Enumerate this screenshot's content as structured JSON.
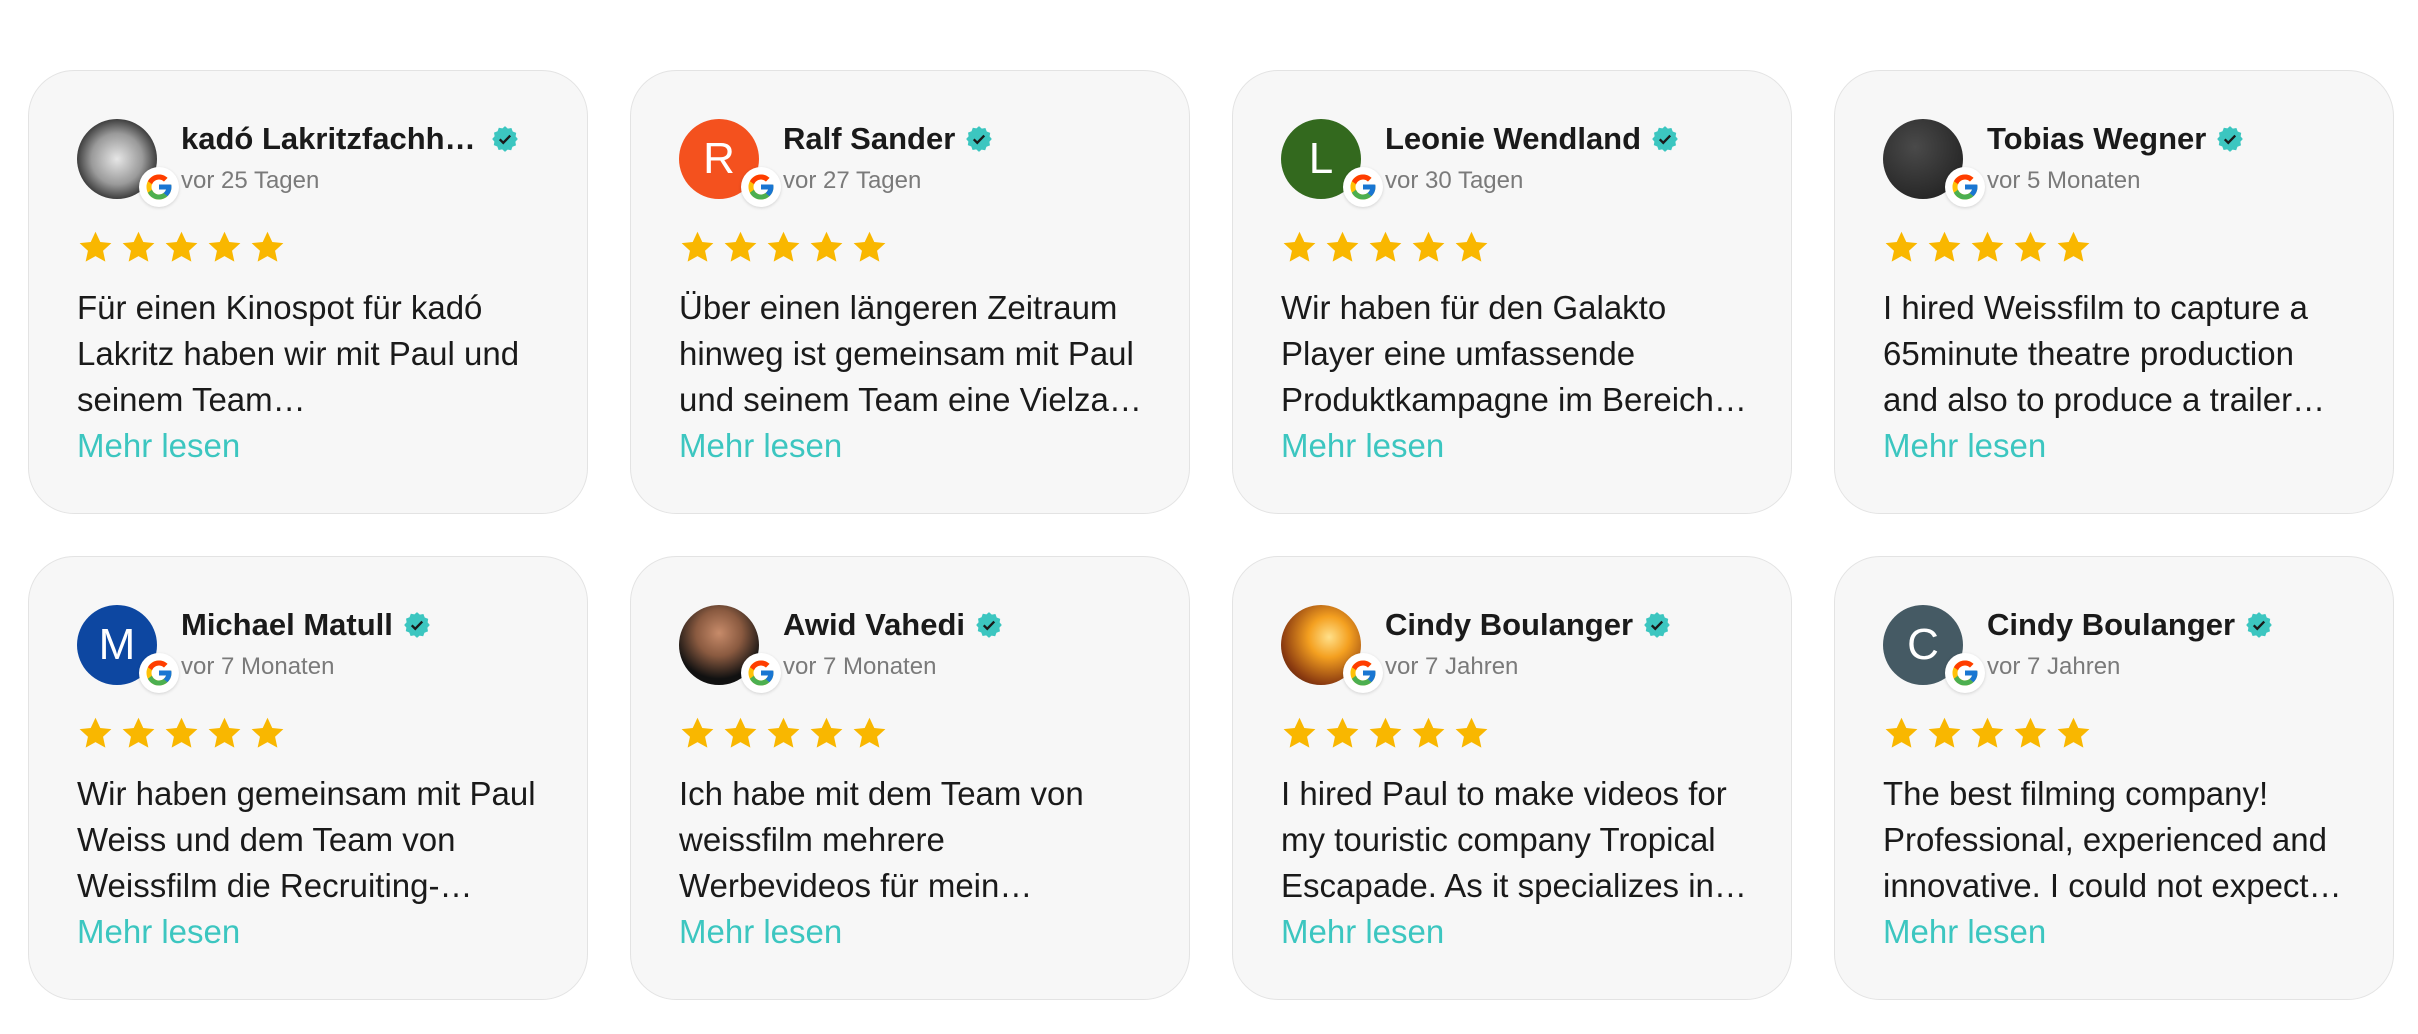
{
  "colors": {
    "accent": "#3cc6c0",
    "star": "#f9b700",
    "card_bg": "#f7f7f7"
  },
  "more_label": "Mehr lesen",
  "reviews": [
    {
      "name": "kadó Lakritzfachha…",
      "date": "vor 25 Tagen",
      "rating": 5,
      "avatar_letter": "",
      "avatar_color": "#2c2c2c",
      "avatar_type": "photo",
      "lines": [
        "Für einen Kinospot für kadó",
        "Lakritz haben wir mit Paul und",
        "seinem Team…"
      ]
    },
    {
      "name": "Ralf Sander",
      "date": "vor 27 Tagen",
      "rating": 5,
      "avatar_letter": "R",
      "avatar_color": "#f4511e",
      "avatar_type": "letter",
      "lines": [
        "Über einen längeren Zeitraum",
        "hinweg ist gemeinsam mit Paul",
        "und seinem Team eine Vielza…"
      ]
    },
    {
      "name": "Leonie Wendland",
      "date": "vor 30 Tagen",
      "rating": 5,
      "avatar_letter": "L",
      "avatar_color": "#33691e",
      "avatar_type": "letter",
      "lines": [
        "Wir haben für den Galakto",
        "Player eine umfassende",
        "Produktkampagne im Bereich…"
      ]
    },
    {
      "name": "Tobias Wegner",
      "date": "vor 5 Monaten",
      "rating": 5,
      "avatar_letter": "",
      "avatar_color": "#4a4a4a",
      "avatar_type": "photo",
      "lines": [
        "I hired Weissfilm to capture a",
        "65minute theatre production",
        "and also to produce a trailer…"
      ]
    },
    {
      "name": "Michael Matull",
      "date": "vor 7 Monaten",
      "rating": 5,
      "avatar_letter": "M",
      "avatar_color": "#0d47a1",
      "avatar_type": "letter",
      "lines": [
        "Wir haben gemeinsam mit Paul",
        "Weiss und dem Team von",
        "Weissfilm die Recruiting-…"
      ]
    },
    {
      "name": "Awid Vahedi",
      "date": "vor 7 Monaten",
      "rating": 5,
      "avatar_letter": "",
      "avatar_color": "#1e1e1e",
      "avatar_type": "photo",
      "lines": [
        "Ich habe mit dem Team von",
        "weissfilm mehrere",
        "Werbevideos für mein…"
      ]
    },
    {
      "name": "Cindy Boulanger",
      "date": "vor 7 Jahren",
      "rating": 5,
      "avatar_letter": "",
      "avatar_color": "#e08a1e",
      "avatar_type": "photo",
      "lines": [
        "I hired Paul to make videos for",
        "my touristic company Tropical",
        "Escapade. As it specializes in…"
      ]
    },
    {
      "name": "Cindy Boulanger",
      "date": "vor 7 Jahren",
      "rating": 5,
      "avatar_letter": "C",
      "avatar_color": "#455a64",
      "avatar_type": "letter",
      "lines": [
        "The best filming company!",
        "Professional, experienced and",
        "innovative. I could not expect…"
      ]
    }
  ]
}
